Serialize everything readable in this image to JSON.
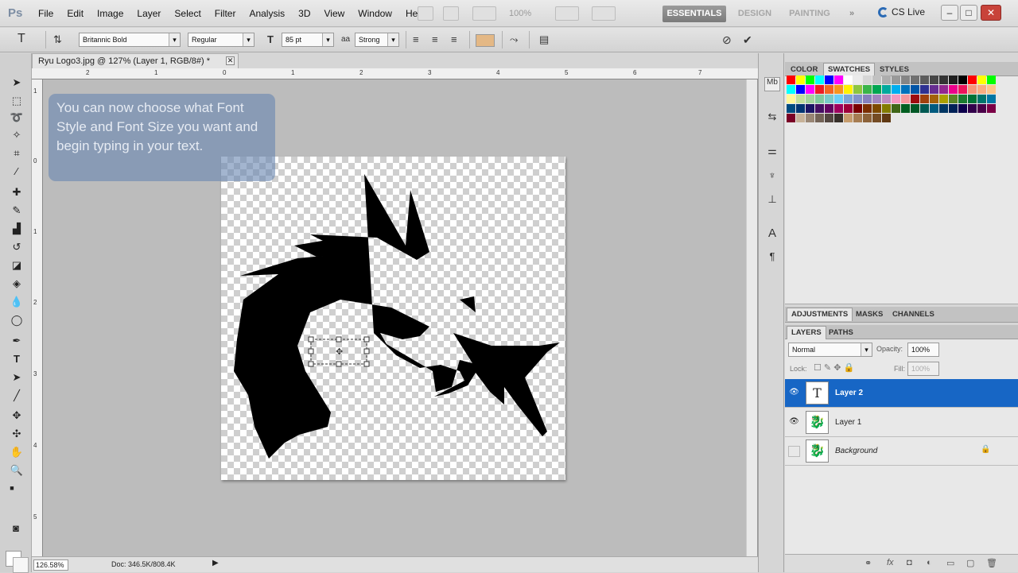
{
  "app": {
    "logo": "Ps",
    "menus": [
      "File",
      "Edit",
      "Image",
      "Layer",
      "Select",
      "Filter",
      "Analysis",
      "3D",
      "View",
      "Window",
      "Help"
    ],
    "zoom": "100%"
  },
  "workspaces": {
    "essentials": "ESSENTIALS",
    "design": "DESIGN",
    "painting": "PAINTING",
    "more": "»",
    "cslive": "CS Live"
  },
  "window_controls": {
    "minimize": "–",
    "restore": "□",
    "close": "✕"
  },
  "options": {
    "font_family": "Britannic Bold",
    "font_style": "Regular",
    "font_size": "85 pt",
    "aa_label": "aa",
    "antialias": "Strong",
    "text_color": "#e4b885"
  },
  "document": {
    "tab": "Ryu Logo3.jpg @ 127% (Layer 1, RGB/8#) *",
    "tab_close": "✕",
    "zoom": "126.58%",
    "doc_size": "Doc: 346.5K/808.4K",
    "status_arrow": "▶"
  },
  "rulers": {
    "top": [
      "2",
      "1",
      "0",
      "1",
      "2",
      "3",
      "4",
      "5",
      "6",
      "7"
    ],
    "left": [
      "1",
      "0",
      "1",
      "2",
      "3",
      "4",
      "5"
    ]
  },
  "tip": "You can now choose what Font Style and Font Size you want and begin typing in your text.",
  "swatch_panel": {
    "tabs": [
      "COLOR",
      "SWATCHES",
      "STYLES"
    ],
    "colors": [
      "#ff0000",
      "#ffff00",
      "#00ff00",
      "#00ffff",
      "#0000ff",
      "#ff00ff",
      "#ffffff",
      "#ebebeb",
      "#d6d6d6",
      "#c2c2c2",
      "#adadad",
      "#999999",
      "#858585",
      "#707070",
      "#5c5c5c",
      "#474747",
      "#333333",
      "#1f1f1f",
      "#000000",
      "#ff0000",
      "#ffff00",
      "#00ff00",
      "#00ffff",
      "#0000ff",
      "#ff00ff",
      "#ed1c24",
      "#f26522",
      "#f7941d",
      "#fff200",
      "#8dc63f",
      "#39b54a",
      "#00a651",
      "#00a99d",
      "#00aeef",
      "#0072bc",
      "#0054a6",
      "#2e3192",
      "#662d91",
      "#92278f",
      "#ec008c",
      "#ed145b",
      "#f69679",
      "#f9ad81",
      "#fdc68a",
      "#fff799",
      "#c4df9b",
      "#a3d39c",
      "#82ca9d",
      "#7accc8",
      "#6dcff6",
      "#7da7d9",
      "#8393ca",
      "#8781bd",
      "#a186be",
      "#bd8cbf",
      "#f49ac1",
      "#f5989d",
      "#9e0b0f",
      "#a0410d",
      "#a36209",
      "#aba000",
      "#598527",
      "#1a7b30",
      "#007236",
      "#00746b",
      "#0076a3",
      "#004b80",
      "#003471",
      "#1b1464",
      "#440e62",
      "#630460",
      "#9e005d",
      "#9e0039",
      "#790000",
      "#7b2e00",
      "#7d4900",
      "#827b00",
      "#406618",
      "#005e20",
      "#005826",
      "#005952",
      "#005b7f",
      "#003663",
      "#002157",
      "#0d004c",
      "#32004b",
      "#4b0049",
      "#7b0046",
      "#7a0026",
      "#c7b299",
      "#998675",
      "#736357",
      "#534741",
      "#37302a",
      "#c69c6d",
      "#a67c52",
      "#8c6239",
      "#754c24",
      "#603913"
    ]
  },
  "adjust_panel": {
    "tabs": [
      "ADJUSTMENTS",
      "MASKS",
      "CHANNELS"
    ]
  },
  "layers_panel": {
    "tabs": [
      "LAYERS",
      "PATHS"
    ],
    "blend": "Normal",
    "opacity_label": "Opacity:",
    "opacity": "100%",
    "lock_label": "Lock:",
    "fill_label": "Fill:",
    "fill": "100%",
    "layers": [
      {
        "name": "Layer 2",
        "thumb": "T",
        "visible": "👁",
        "selected": true
      },
      {
        "name": "Layer 1",
        "thumb": "🐉",
        "visible": "👁",
        "selected": false
      },
      {
        "name": "Background",
        "thumb": "🐉",
        "visible": "",
        "selected": false,
        "lock": "🔒"
      }
    ]
  },
  "layer_buttons": [
    "⚭",
    "fx",
    "◘",
    "◐",
    "▭",
    "▢",
    "🗑"
  ]
}
